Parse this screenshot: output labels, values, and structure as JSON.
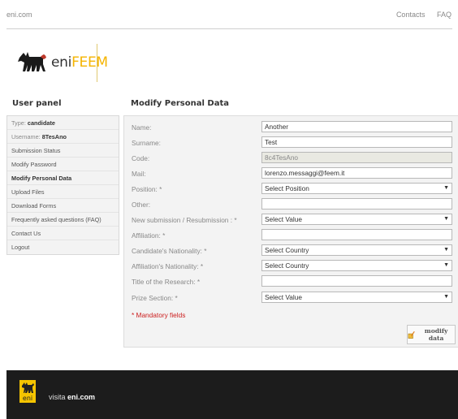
{
  "header": {
    "site_link": "eni.com",
    "nav": [
      "Contacts",
      "FAQ"
    ]
  },
  "logo": {
    "eni": "eni",
    "feem": "FEEM"
  },
  "sidebar": {
    "title": "User panel",
    "type_label": "Type:",
    "type_value": "candidate",
    "username_label": "Username:",
    "username_value": "8TesAno",
    "items": [
      "Submission Status",
      "Modify Password",
      "Modify Personal Data",
      "Upload Files",
      "Download Forms",
      "Frequently asked questions (FAQ)",
      "Contact Us",
      "Logout"
    ],
    "active_item": "Modify Personal Data"
  },
  "main": {
    "title": "Modify Personal Data",
    "fields": {
      "name": {
        "label": "Name:",
        "value": "Another"
      },
      "surname": {
        "label": "Surname:",
        "value": "Test"
      },
      "code": {
        "label": "Code:",
        "value": "8c4TesAno"
      },
      "mail": {
        "label": "Mail:",
        "value": "lorenzo.messaggi@feem.it"
      },
      "position": {
        "label": "Position: *",
        "value": "Select Position"
      },
      "other": {
        "label": "Other:",
        "value": ""
      },
      "submission": {
        "label": "New submission / Resubmission : *",
        "value": "Select Value"
      },
      "affiliation": {
        "label": "Affiliation: *",
        "value": ""
      },
      "candidate_nationality": {
        "label": "Candidate's Nationality: *",
        "value": "Select Country"
      },
      "affiliation_nationality": {
        "label": "Affiliation's Nationality: *",
        "value": "Select Country"
      },
      "research_title": {
        "label": "Title of the Research: *",
        "value": ""
      },
      "prize_section": {
        "label": "Prize Section: *",
        "value": "Select Value"
      }
    },
    "mandatory_note": "* Mandatory fields",
    "submit_label": "modify data"
  },
  "footer": {
    "visit_prefix": "visita",
    "visit_site": "eni.com",
    "logo_text": "eni"
  },
  "colors": {
    "accent": "#f5b400",
    "mandatory": "#cc2020",
    "footer_bg": "#1c1c1c"
  }
}
